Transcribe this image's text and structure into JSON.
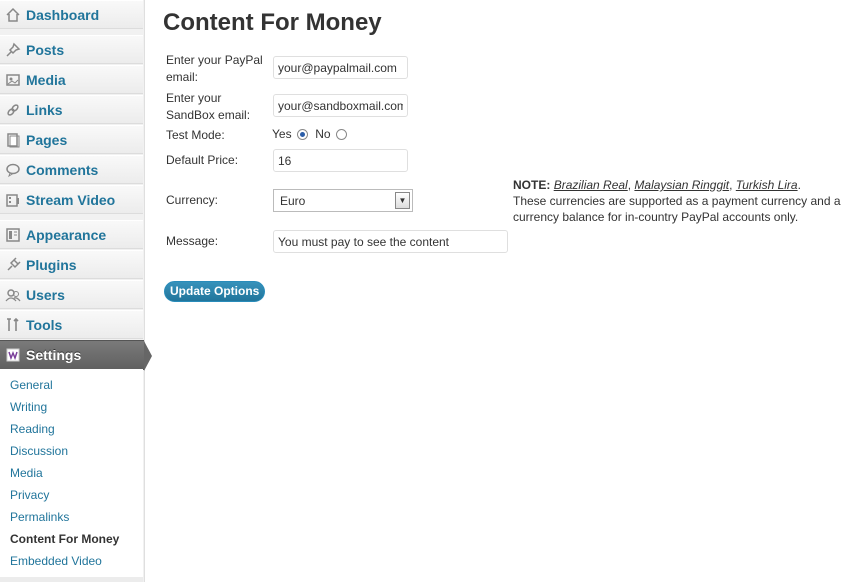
{
  "sidebar": {
    "items": [
      {
        "label": "Dashboard",
        "icon": "dashboard-icon"
      },
      {
        "label": "Posts",
        "icon": "pushpin-icon"
      },
      {
        "label": "Media",
        "icon": "media-icon"
      },
      {
        "label": "Links",
        "icon": "links-icon"
      },
      {
        "label": "Pages",
        "icon": "pages-icon"
      },
      {
        "label": "Comments",
        "icon": "comments-icon"
      },
      {
        "label": "Stream Video",
        "icon": "video-icon"
      },
      {
        "label": "Appearance",
        "icon": "appearance-icon"
      },
      {
        "label": "Plugins",
        "icon": "plugins-icon"
      },
      {
        "label": "Users",
        "icon": "users-icon"
      },
      {
        "label": "Tools",
        "icon": "tools-icon"
      },
      {
        "label": "Settings",
        "icon": "settings-icon",
        "current": true
      }
    ],
    "submenu": [
      {
        "label": "General"
      },
      {
        "label": "Writing"
      },
      {
        "label": "Reading"
      },
      {
        "label": "Discussion"
      },
      {
        "label": "Media"
      },
      {
        "label": "Privacy"
      },
      {
        "label": "Permalinks"
      },
      {
        "label": "Content For Money",
        "current": true
      },
      {
        "label": "Embedded Video"
      }
    ]
  },
  "main": {
    "title": "Content For Money",
    "form": {
      "paypal_label_1": "Enter your PayPal",
      "paypal_label_2": "email:",
      "paypal_value": "your@paypalmail.com",
      "sandbox_label_1": "Enter your",
      "sandbox_label_2": "SandBox email:",
      "sandbox_value": "your@sandboxmail.com",
      "test_mode_label": "Test Mode:",
      "test_mode_yes": "Yes",
      "test_mode_no": "No",
      "test_mode_selected": "Yes",
      "price_label": "Default Price:",
      "price_value": "16",
      "currency_label": "Currency:",
      "currency_value": "Euro",
      "message_label": "Message:",
      "message_value": "You must pay to see the content",
      "submit_label": "Update Options"
    },
    "note": {
      "prefix": "NOTE:",
      "currencies": [
        "Brazilian Real",
        "Malaysian Ringgit",
        "Turkish Lira"
      ],
      "text": "These currencies are supported as a payment currency and a currency balance for in-country PayPal accounts only."
    }
  },
  "colors": {
    "link": "#21759b",
    "button": "#21759b",
    "current_menu": "#6d6d6d"
  }
}
